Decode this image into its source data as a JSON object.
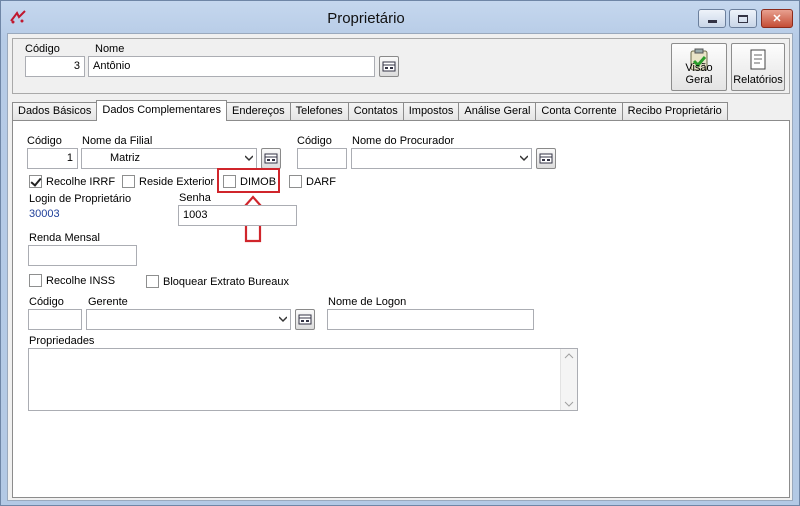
{
  "window": {
    "title": "Proprietário"
  },
  "header": {
    "codigo_label": "Código",
    "codigo_value": "3",
    "nome_label": "Nome",
    "nome_value": "Antônio",
    "visao_geral_label": "Visão Geral",
    "relatorios_label": "Relatórios"
  },
  "tabs": [
    {
      "label": "Dados Básicos"
    },
    {
      "label": "Dados Complementares",
      "active": true
    },
    {
      "label": "Endereços"
    },
    {
      "label": "Telefones"
    },
    {
      "label": "Contatos"
    },
    {
      "label": "Impostos"
    },
    {
      "label": "Análise Geral"
    },
    {
      "label": "Conta Corrente"
    },
    {
      "label": "Recibo Proprietário"
    }
  ],
  "form": {
    "filial_codigo_label": "Código",
    "filial_codigo_value": "1",
    "filial_nome_label": "Nome da Filial",
    "filial_nome_value": "Matriz",
    "procurador_codigo_label": "Código",
    "procurador_codigo_value": "",
    "procurador_nome_label": "Nome do Procurador",
    "procurador_nome_value": "",
    "recolhe_irrf_label": "Recolhe IRRF",
    "recolhe_irrf_checked": true,
    "reside_exterior_label": "Reside Exterior",
    "reside_exterior_checked": false,
    "dimob_label": "DIMOB",
    "dimob_checked": false,
    "darf_label": "DARF",
    "darf_checked": false,
    "login_label": "Login de Proprietário",
    "login_value": "30003",
    "senha_label": "Senha",
    "senha_value": "1003",
    "renda_label": "Renda Mensal",
    "renda_value": "",
    "recolhe_inss_label": "Recolhe INSS",
    "recolhe_inss_checked": false,
    "bloquear_label": "Bloquear Extrato Bureaux",
    "bloquear_checked": false,
    "gerente_codigo_label": "Código",
    "gerente_codigo_value": "",
    "gerente_label": "Gerente",
    "gerente_value": "",
    "logon_label": "Nome de Logon",
    "logon_value": "",
    "propriedades_label": "Propriedades",
    "propriedades_value": ""
  },
  "colors": {
    "highlight": "#d0252b",
    "link_blue": "#1f3f99"
  }
}
